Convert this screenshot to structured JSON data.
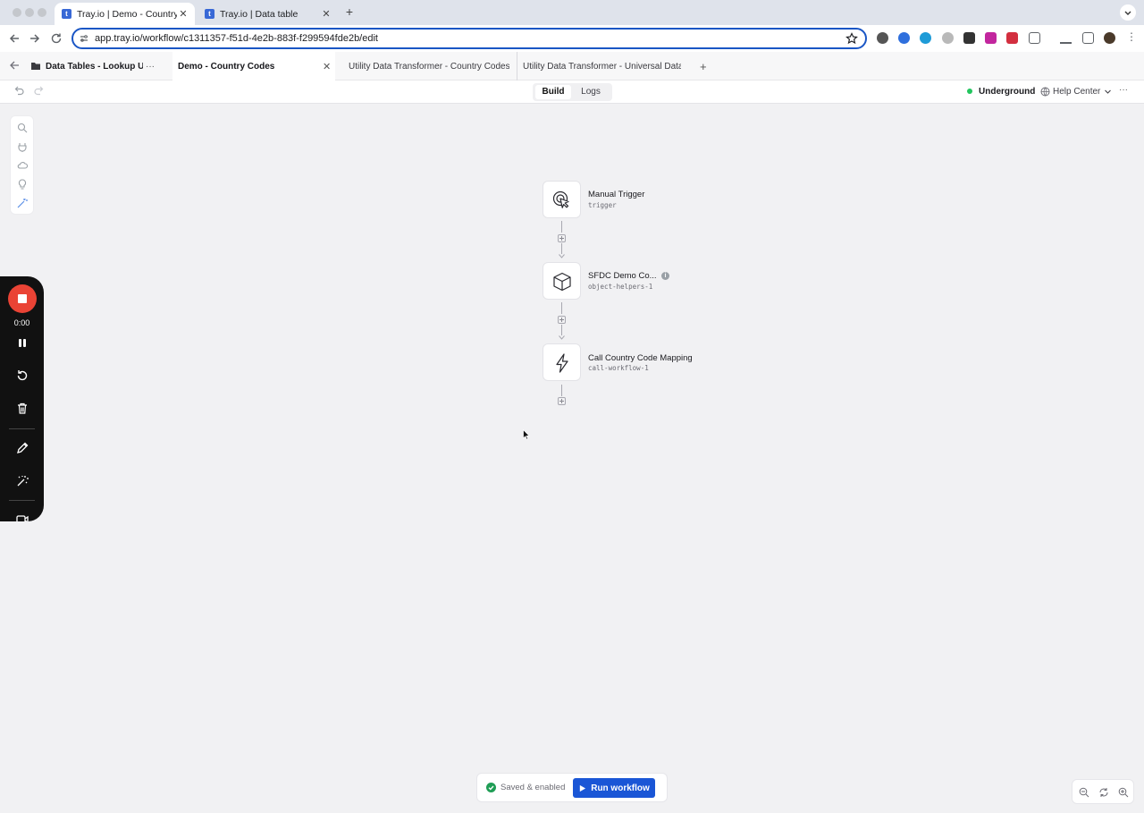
{
  "browser": {
    "tabs": [
      {
        "title": "Tray.io | Demo - Country Codes",
        "active": true
      },
      {
        "title": "Tray.io | Data table",
        "active": false
      }
    ],
    "url": "app.tray.io/workflow/c1311357-f51d-4e2b-883f-f299594fde2b/edit"
  },
  "app": {
    "tabs": [
      {
        "label": "Data Tables - Lookup Use",
        "type": "folder"
      },
      {
        "label": "Demo - Country Codes",
        "active": true
      },
      {
        "label": "Utility Data Transformer - Country Codes"
      },
      {
        "label": "Utility Data Transformer - Universal Data"
      }
    ],
    "more_label": "···",
    "modes": {
      "build": "Build",
      "logs": "Logs",
      "selected": "Build"
    },
    "workspace": "Underground",
    "workspace_status_color": "#22c55e",
    "help": "Help Center"
  },
  "recorder": {
    "time": "0:00"
  },
  "flow": {
    "steps": [
      {
        "title": "Manual Trigger",
        "name": "trigger",
        "icon": "cursor-click-icon"
      },
      {
        "title": "SFDC Demo Co...",
        "name": "object-helpers-1",
        "icon": "box-icon"
      },
      {
        "title": "Call Country Code Mapping",
        "name": "call-workflow-1",
        "icon": "lightning-icon"
      }
    ]
  },
  "footer": {
    "status": "Saved & enabled",
    "status_color": "#1f9d55",
    "run_label": "Run workflow",
    "accent": "#1a56d6"
  }
}
